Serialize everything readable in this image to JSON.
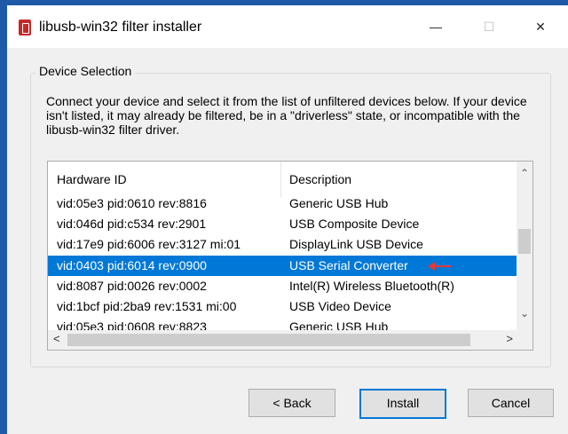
{
  "window": {
    "title": "libusb-win32 filter installer",
    "minimize_glyph": "—",
    "maximize_glyph": "☐",
    "close_glyph": "✕",
    "icon": "usb-app-icon",
    "accent_color": "#1e5aa8"
  },
  "group": {
    "title": "Device Selection",
    "instructions": "Connect your device and select it from the list of unfiltered devices below. If your device isn't listed, it may already be filtered, be in a \"driverless\" state, or incompatible with the libusb-win32 filter driver."
  },
  "table": {
    "columns": [
      "Hardware ID",
      "Description"
    ],
    "rows": [
      {
        "hw": "vid:05e3 pid:0610 rev:8816",
        "desc": "Generic USB Hub"
      },
      {
        "hw": "vid:046d pid:c534 rev:2901",
        "desc": "USB Composite Device"
      },
      {
        "hw": "vid:17e9 pid:6006 rev:3127 mi:01",
        "desc": "DisplayLink USB Device"
      },
      {
        "hw": "vid:0403 pid:6014 rev:0900",
        "desc": "USB Serial Converter"
      },
      {
        "hw": "vid:8087 pid:0026 rev:0002",
        "desc": "Intel(R) Wireless Bluetooth(R)"
      },
      {
        "hw": "vid:1bcf pid:2ba9 rev:1531 mi:00",
        "desc": "USB Video Device"
      },
      {
        "hw": "vid:05e3 pid:0608 rev:8823",
        "desc": "Generic USB Hub"
      }
    ],
    "selected_index": 3,
    "selection_color": "#0078d7",
    "scroll_up_glyph": "⌃",
    "scroll_down_glyph": "⌄",
    "scroll_left_glyph": "<",
    "scroll_right_glyph": ">"
  },
  "buttons": {
    "back": "< Back",
    "install": "Install",
    "cancel": "Cancel"
  }
}
